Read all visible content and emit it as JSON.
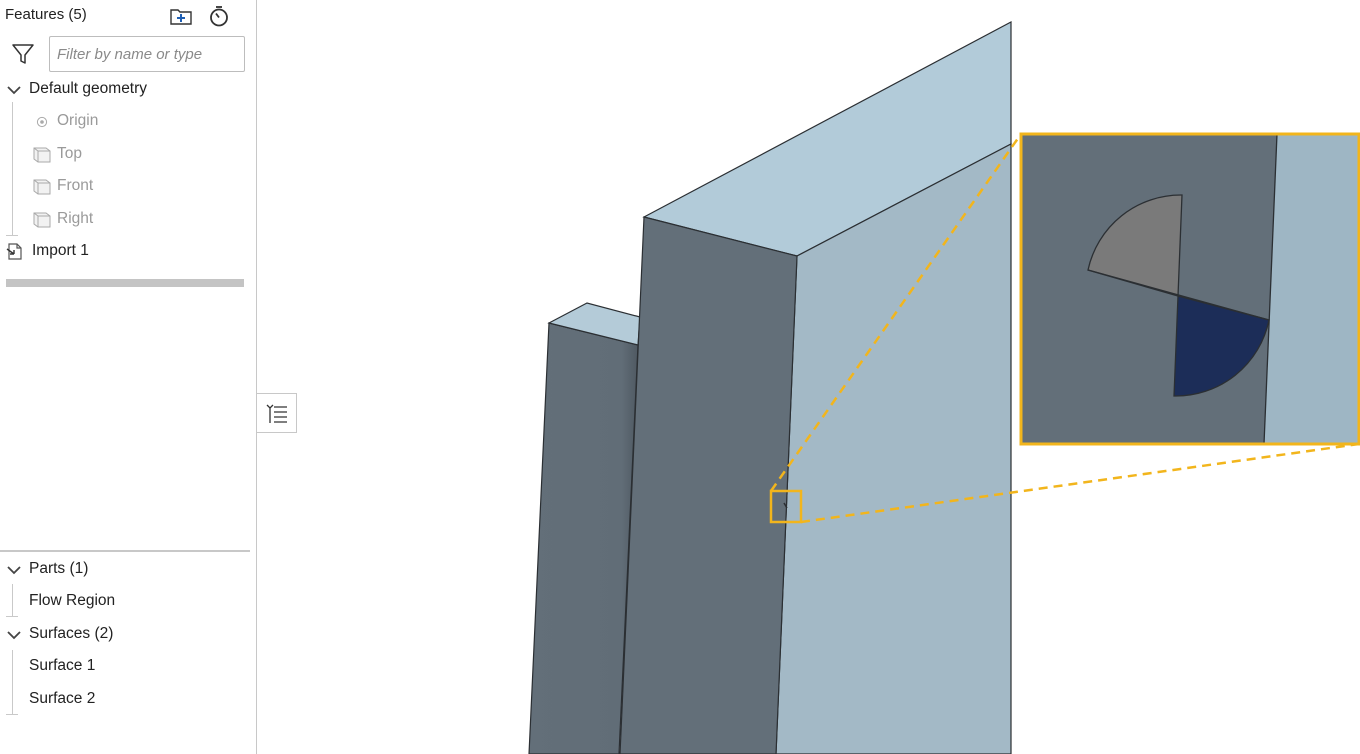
{
  "features_panel": {
    "title": "Features (5)",
    "add_folder_icon": "folder-plus-icon",
    "timer_icon": "stopwatch-icon",
    "filter_icon": "funnel-icon",
    "filter_placeholder": "Filter by name or type",
    "default_geometry": {
      "label": "Default geometry",
      "items": [
        {
          "label": "Origin",
          "icon": "origin-icon"
        },
        {
          "label": "Top",
          "icon": "plane-icon"
        },
        {
          "label": "Front",
          "icon": "plane-icon"
        },
        {
          "label": "Right",
          "icon": "plane-icon"
        }
      ]
    },
    "features": [
      {
        "label": "Import 1",
        "icon": "import-icon"
      }
    ]
  },
  "parts_panel": {
    "parts": {
      "label": "Parts (1)",
      "items": [
        {
          "label": "Flow Region"
        }
      ]
    },
    "surfaces": {
      "label": "Surfaces (2)",
      "items": [
        {
          "label": "Surface 1"
        },
        {
          "label": "Surface 2"
        }
      ]
    }
  },
  "collapse_tab_icon": "list-collapse-icon",
  "colors": {
    "highlight": "#F2B51C",
    "face_light": "#A3B9C6",
    "face_top": "#B2CBD9",
    "face_dark": "#636F79",
    "selection_blue": "#1C2D58",
    "selection_gray": "#7A7A7A"
  }
}
